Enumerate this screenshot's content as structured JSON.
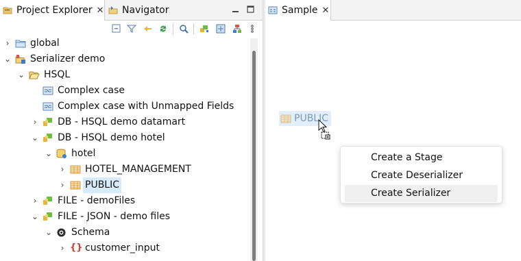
{
  "left_panel": {
    "tabs": [
      {
        "label": "Project Explorer",
        "close": "✕",
        "icon": "project-explorer-icon"
      },
      {
        "label": "Navigator",
        "icon": "navigator-icon"
      }
    ]
  },
  "editor": {
    "tab": {
      "label": "Sample",
      "close": "✕",
      "icon": "diagram-icon"
    },
    "node_label": "PUBLIC"
  },
  "tree": [
    {
      "label": "global",
      "icon": "project-folder-icon",
      "expanded": false
    },
    {
      "label": "Serializer demo",
      "icon": "serializer-project-icon",
      "expanded": true
    },
    {
      "label": "HSQL",
      "icon": "folder-open-icon",
      "expanded": true
    },
    {
      "label": "Complex case",
      "icon": "mapping-icon"
    },
    {
      "label": "Complex case with Unmapped Fields",
      "icon": "mapping-icon"
    },
    {
      "label": "DB - HSQL demo datamart",
      "icon": "connection-icon",
      "expanded": false
    },
    {
      "label": "DB - HSQL demo hotel",
      "icon": "connection-icon",
      "expanded": true
    },
    {
      "label": "hotel",
      "icon": "database-icon",
      "expanded": true
    },
    {
      "label": "HOTEL_MANAGEMENT",
      "icon": "table-icon",
      "expanded": false
    },
    {
      "label": "PUBLIC",
      "icon": "table-icon",
      "expanded": false,
      "selected": true
    },
    {
      "label": "FILE - demoFiles",
      "icon": "connection-icon",
      "expanded": false
    },
    {
      "label": "FILE - JSON - demo files",
      "icon": "connection-icon",
      "expanded": true
    },
    {
      "label": "Schema",
      "icon": "schema-icon",
      "expanded": true
    },
    {
      "label": "customer_input",
      "icon": "json-braces-icon",
      "expanded": false
    }
  ],
  "context_menu": {
    "items": [
      "Create a Stage",
      "Create Deserializer",
      "Create Serializer"
    ],
    "highlighted": "Create Serializer"
  }
}
